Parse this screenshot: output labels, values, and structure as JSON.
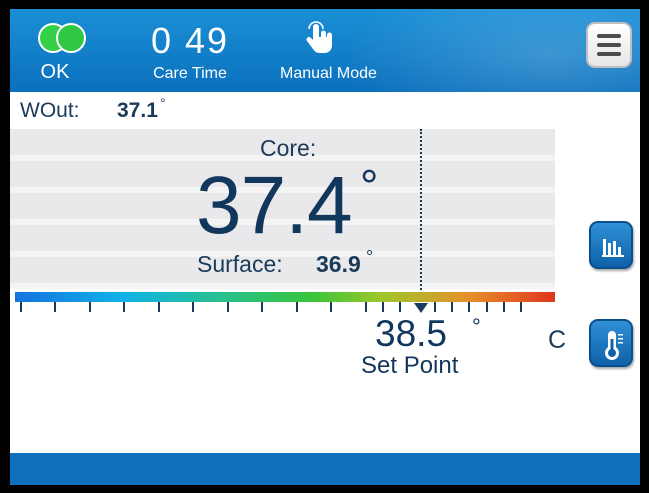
{
  "header": {
    "status": {
      "label": "OK",
      "icon": "status-ok-icon",
      "color": "#35d04a"
    },
    "care_time": {
      "value": "0 49",
      "label": "Care Time"
    },
    "mode": {
      "label": "Manual Mode",
      "icon": "hand-pointer-icon"
    },
    "menu": {
      "icon": "menu-icon"
    }
  },
  "water_out": {
    "label": "WOut:",
    "value": "37.1",
    "degree": "°"
  },
  "core": {
    "label": "Core:",
    "value": "37.4",
    "degree": "°"
  },
  "surface": {
    "label": "Surface:",
    "value": "36.9",
    "degree": "°"
  },
  "set_point": {
    "value": "38.5",
    "degree": "°",
    "label": "Set Point",
    "unit": "C"
  },
  "scale": {
    "icon": "temperature-gradient-scale",
    "setpoint_marker": "down-arrow-icon"
  },
  "side_buttons": [
    {
      "icon": "bar-chart-icon"
    },
    {
      "icon": "thermometer-icon"
    }
  ],
  "colors": {
    "header_blue": "#0b70bd",
    "text_navy": "#12375d",
    "status_green": "#35d04a",
    "button_blue": "#0e62aa"
  }
}
